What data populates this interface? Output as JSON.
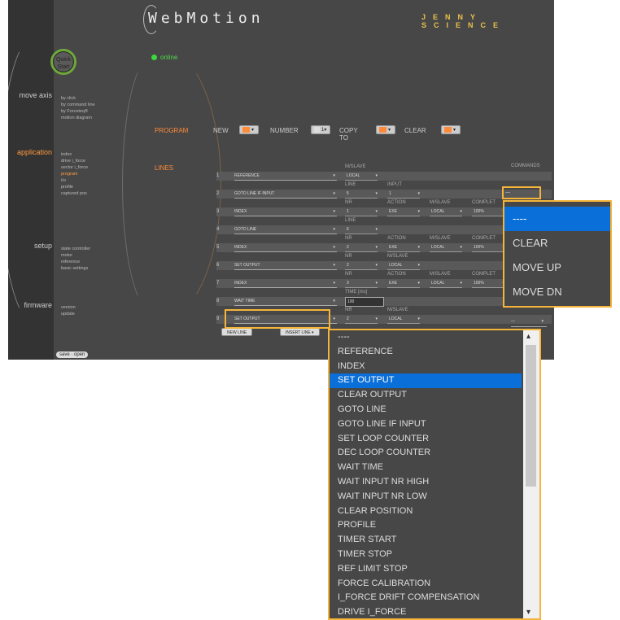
{
  "app": {
    "logo": "WebMotion",
    "brand": "JENNY SCIENCE",
    "quick_start": "Quick Start",
    "status": "online"
  },
  "nav": [
    {
      "label": "move axis",
      "active": false,
      "items": [
        "by click",
        "by command line",
        "by Forceteq®",
        "motion diagram"
      ]
    },
    {
      "label": "application",
      "active": true,
      "items": [
        "index",
        "drive i_force",
        "sector i_force",
        "program",
        "i/o",
        "profile",
        "captured pos"
      ],
      "active_item": "program"
    },
    {
      "label": "setup",
      "active": false,
      "items": [
        "state controller",
        "motor",
        "reference",
        "basic settings"
      ]
    },
    {
      "label": "firmware",
      "active": false,
      "items": [
        "version",
        "update"
      ]
    }
  ],
  "program": {
    "label": "PROGRAM",
    "new_label": "NEW",
    "new_value": "—",
    "number_label": "NUMBER",
    "number_value": "1",
    "copy_label": "COPY TO",
    "copy_value": "—",
    "clear_label": "CLEAR",
    "clear_value": "—"
  },
  "lines_label": "LINES",
  "commands_label": "COMMANDS",
  "lines": [
    {
      "num": "1",
      "cmd": "REFERENCE",
      "cols": [
        {
          "hdr": "M/SLAVE",
          "val": "LOCAL"
        }
      ]
    },
    {
      "num": "2",
      "cmd": "GOTO LINE IF INPUT",
      "cols": [
        {
          "hdr": "LINE",
          "val": "5"
        },
        {
          "hdr": "INPUT",
          "val": "1"
        }
      ]
    },
    {
      "num": "3",
      "cmd": "INDEX",
      "cols": [
        {
          "hdr": "NR",
          "val": "1"
        },
        {
          "hdr": "ACTION",
          "val": "EXE"
        },
        {
          "hdr": "M/SLAVE",
          "val": "LOCAL"
        },
        {
          "hdr": "COMPLET",
          "val": "100%"
        }
      ]
    },
    {
      "num": "4",
      "cmd": "GOTO LINE",
      "cols": [
        {
          "hdr": "LINE",
          "val": "6"
        }
      ]
    },
    {
      "num": "5",
      "cmd": "INDEX",
      "cols": [
        {
          "hdr": "NR",
          "val": "2"
        },
        {
          "hdr": "ACTION",
          "val": "EXE"
        },
        {
          "hdr": "M/SLAVE",
          "val": "LOCAL"
        },
        {
          "hdr": "COMPLET",
          "val": "100%"
        }
      ]
    },
    {
      "num": "6",
      "cmd": "SET OUTPUT",
      "cols": [
        {
          "hdr": "NR",
          "val": "2"
        },
        {
          "hdr": "M/SLAVE",
          "val": "LOCAL"
        }
      ]
    },
    {
      "num": "7",
      "cmd": "INDEX",
      "cols": [
        {
          "hdr": "NR",
          "val": "3"
        },
        {
          "hdr": "ACTION",
          "val": "EXE"
        },
        {
          "hdr": "M/SLAVE",
          "val": "LOCAL"
        },
        {
          "hdr": "COMPLET",
          "val": "100%"
        }
      ]
    },
    {
      "num": "8",
      "cmd": "WAIT TIME",
      "cols": [
        {
          "hdr": "TIME [ms]",
          "val": "100"
        }
      ]
    },
    {
      "num": "9",
      "cmd": "SET OUTPUT",
      "cols": [
        {
          "hdr": "NR",
          "val": "2"
        },
        {
          "hdr": "M/SLAVE",
          "val": "LOCAL"
        }
      ]
    }
  ],
  "buttons": {
    "new_line": "NEW LINE",
    "insert_line": "INSERT LINE",
    "save_open": "save · open"
  },
  "command_dropdown": {
    "value": "—",
    "options": [
      "----",
      "CLEAR",
      "MOVE UP",
      "MOVE DN"
    ],
    "selected": 0
  },
  "command_list": {
    "options": [
      "----",
      "REFERENCE",
      "INDEX",
      "SET OUTPUT",
      "CLEAR OUTPUT",
      "GOTO LINE",
      "GOTO LINE IF INPUT",
      "SET LOOP COUNTER",
      "DEC LOOP COUNTER",
      "WAIT TIME",
      "WAIT INPUT NR HIGH",
      "WAIT INPUT NR LOW",
      "CLEAR POSITION",
      "PROFILE",
      "TIMER START",
      "TIMER STOP",
      "REF LIMIT STOP",
      "FORCE CALIBRATION",
      "I_FORCE DRIFT COMPENSATION",
      "DRIVE I_FORCE"
    ],
    "selected": 3
  },
  "colors": {
    "accent": "#ff8a3a",
    "highlight": "#f5b53a",
    "selection": "#0a6fd8",
    "online": "#3bd93b"
  }
}
